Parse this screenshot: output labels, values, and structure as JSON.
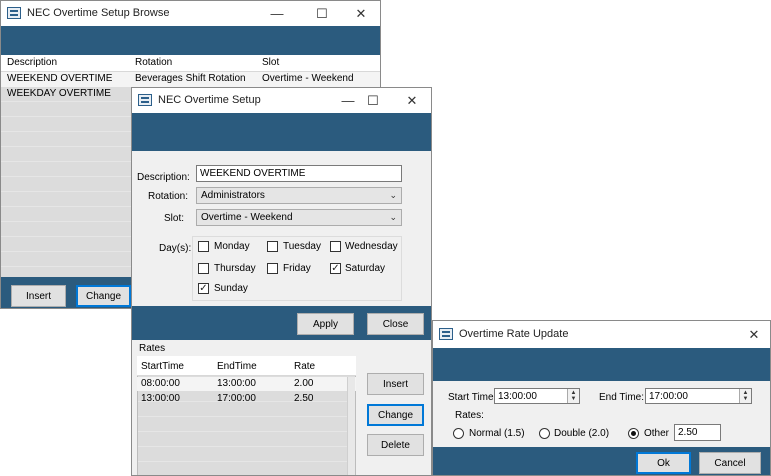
{
  "browse": {
    "title": "NEC Overtime Setup Browse",
    "columns": [
      "Description",
      "Rotation",
      "Slot"
    ],
    "rows": [
      [
        "WEEKEND OVERTIME",
        "Beverages Shift Rotation",
        "Overtime - Weekend"
      ],
      [
        "WEEKDAY OVERTIME",
        "",
        ""
      ]
    ],
    "insert_label": "Insert",
    "change_label": "Change"
  },
  "setup": {
    "title": "NEC Overtime Setup",
    "description_label": "Description:",
    "description_value": "WEEKEND OVERTIME",
    "rotation_label": "Rotation:",
    "rotation_value": "Administrators",
    "slot_label": "Slot:",
    "slot_value": "Overtime - Weekend",
    "days_label": "Day(s):",
    "days": {
      "monday": {
        "label": "Monday",
        "checked": false
      },
      "tuesday": {
        "label": "Tuesday",
        "checked": false
      },
      "wednesday": {
        "label": "Wednesday",
        "checked": false
      },
      "thursday": {
        "label": "Thursday",
        "checked": false
      },
      "friday": {
        "label": "Friday",
        "checked": false
      },
      "saturday": {
        "label": "Saturday",
        "checked": true
      },
      "sunday": {
        "label": "Sunday",
        "checked": true
      }
    },
    "apply_label": "Apply",
    "close_label": "Close",
    "rates_label": "Rates",
    "rates_columns": [
      "StartTime",
      "EndTime",
      "Rate"
    ],
    "rates_rows": [
      [
        "08:00:00",
        "13:00:00",
        "2.00"
      ],
      [
        "13:00:00",
        "17:00:00",
        "2.50"
      ]
    ],
    "insert_label": "Insert",
    "change_label": "Change",
    "delete_label": "Delete"
  },
  "rate_update": {
    "title": "Overtime Rate Update",
    "start_label": "Start Time:",
    "start_value": "13:00:00",
    "end_label": "End Time:",
    "end_value": "17:00:00",
    "rates_label": "Rates:",
    "normal_label": "Normal (1.5)",
    "double_label": "Double (2.0)",
    "other_label": "Other",
    "selected": "other",
    "other_value": "2.50",
    "ok_label": "Ok",
    "cancel_label": "Cancel"
  },
  "icons": {
    "minimize": "minimize-icon",
    "maximize": "maximize-icon",
    "close": "close-icon"
  },
  "colors": {
    "header_blue": "#2b5b7e",
    "focus_blue": "#0078d7"
  }
}
